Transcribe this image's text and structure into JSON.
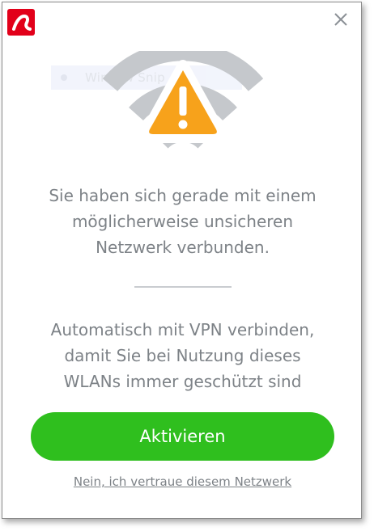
{
  "colors": {
    "brand": "#e2001a",
    "accent": "#2fbf1e",
    "warning": "#f7a21b",
    "wifi": "#c5c8cc",
    "text": "#7d8287"
  },
  "titlebar": {
    "logo_icon": "avira-umbrella-logo-icon",
    "close_icon": "close-icon"
  },
  "background_snip": {
    "label": "Window Snip"
  },
  "hero": {
    "icon": "wifi-warning-icon"
  },
  "message": {
    "lines": [
      "Sie haben sich gerade mit einem",
      "möglicherweise unsicheren",
      "Netzwerk verbunden."
    ]
  },
  "vpn_prompt": {
    "lines": [
      "Automatisch mit VPN verbinden,",
      "damit Sie bei Nutzung dieses",
      "WLANs immer geschützt sind"
    ]
  },
  "actions": {
    "activate_label": "Aktivieren",
    "trust_label": "Nein, ich vertraue diesem Netzwerk"
  }
}
